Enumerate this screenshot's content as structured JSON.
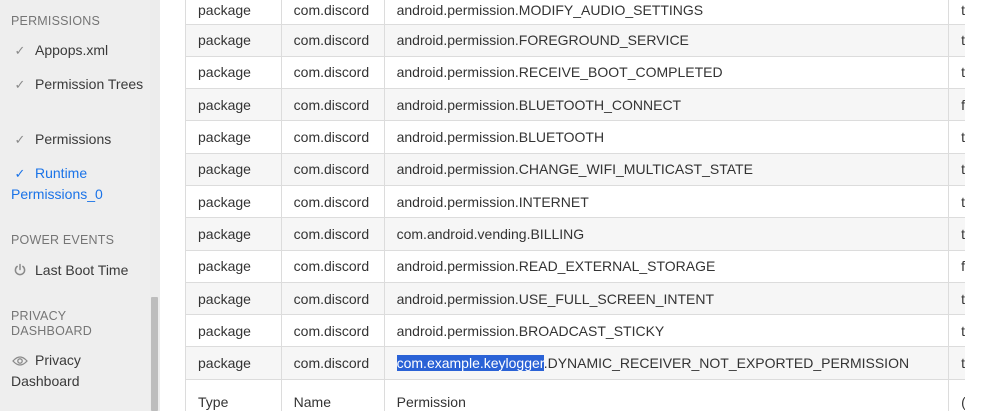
{
  "sidebar": {
    "permissions_section": "PERMISSIONS",
    "items": [
      {
        "label": "Appops.xml",
        "icon": "check-icon"
      },
      {
        "label": "Permission Trees",
        "icon": "check-icon"
      },
      {
        "label": "Permissions",
        "icon": "check-icon"
      },
      {
        "label": "Runtime Permissions_0",
        "icon": "check-icon",
        "active": true
      }
    ],
    "power_section": "POWER EVENTS",
    "power_items": [
      {
        "label": "Last Boot Time",
        "icon": "power-icon"
      }
    ],
    "privacy_section": "PRIVACY DASHBOARD",
    "privacy_items": [
      {
        "label": "Privacy Dashboard",
        "icon": "eye-icon"
      }
    ]
  },
  "table": {
    "rows": [
      {
        "type": "package",
        "name": "com.discord",
        "permission": "android.permission.MODIFY_AUDIO_SETTINGS",
        "granted": "t"
      },
      {
        "type": "package",
        "name": "com.discord",
        "permission": "android.permission.FOREGROUND_SERVICE",
        "granted": "t"
      },
      {
        "type": "package",
        "name": "com.discord",
        "permission": "android.permission.RECEIVE_BOOT_COMPLETED",
        "granted": "t"
      },
      {
        "type": "package",
        "name": "com.discord",
        "permission": "android.permission.BLUETOOTH_CONNECT",
        "granted": "f"
      },
      {
        "type": "package",
        "name": "com.discord",
        "permission": "android.permission.BLUETOOTH",
        "granted": "t"
      },
      {
        "type": "package",
        "name": "com.discord",
        "permission": "android.permission.CHANGE_WIFI_MULTICAST_STATE",
        "granted": "t"
      },
      {
        "type": "package",
        "name": "com.discord",
        "permission": "android.permission.INTERNET",
        "granted": "t"
      },
      {
        "type": "package",
        "name": "com.discord",
        "permission": "com.android.vending.BILLING",
        "granted": "t"
      },
      {
        "type": "package",
        "name": "com.discord",
        "permission": "android.permission.READ_EXTERNAL_STORAGE",
        "granted": "f"
      },
      {
        "type": "package",
        "name": "com.discord",
        "permission": "android.permission.USE_FULL_SCREEN_INTENT",
        "granted": "t"
      },
      {
        "type": "package",
        "name": "com.discord",
        "permission": "android.permission.BROADCAST_STICKY",
        "granted": "t"
      }
    ],
    "last_row": {
      "type": "package",
      "name": "com.discord",
      "permission_selected": "com.example.keylogger",
      "permission_rest": ".DYNAMIC_RECEIVER_NOT_EXPORTED_PERMISSION",
      "granted": "t"
    },
    "header": {
      "type": "Type",
      "name": "Name",
      "permission": "Permission",
      "granted": "("
    }
  },
  "colors": {
    "accent": "#1a73e8",
    "selection": "#2a62d6",
    "sidebar_bg": "#eeeeee"
  }
}
